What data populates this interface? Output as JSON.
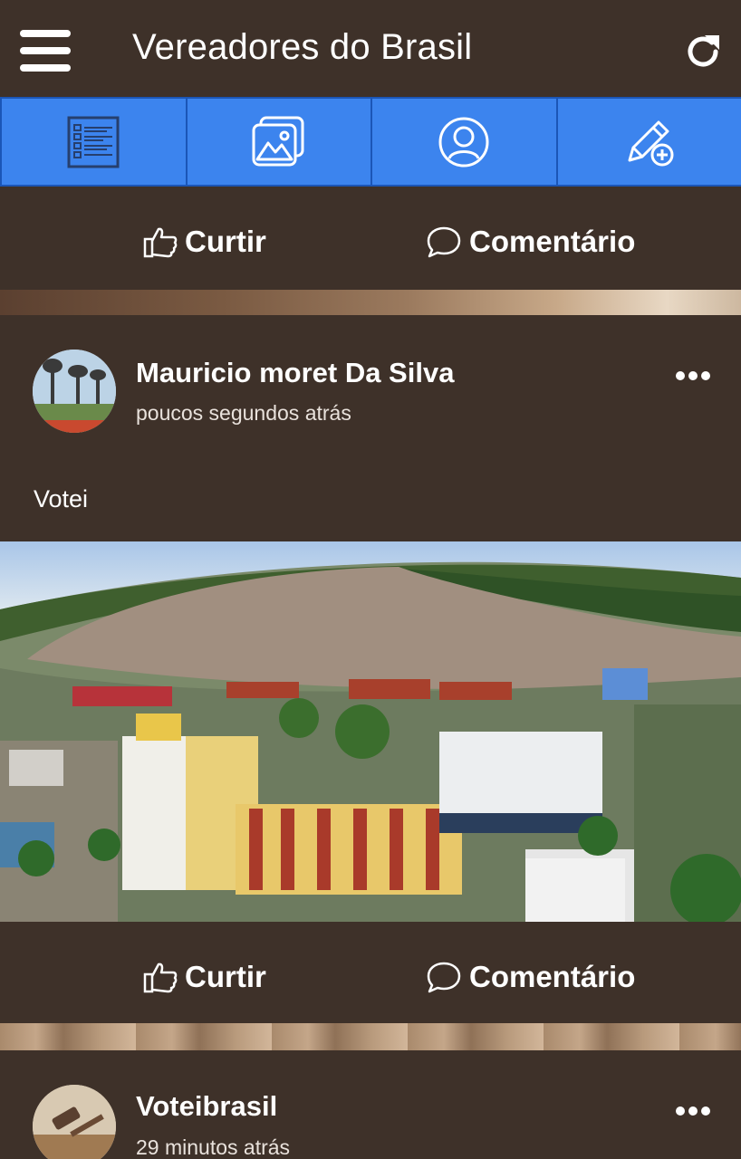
{
  "header": {
    "title": "Vereadores do Brasil",
    "menu_icon": "hamburger-menu-icon",
    "refresh_icon": "refresh-icon"
  },
  "tabs": [
    {
      "icon": "feed-list-icon"
    },
    {
      "icon": "gallery-icon"
    },
    {
      "icon": "profile-icon"
    },
    {
      "icon": "edit-add-icon"
    }
  ],
  "actions_top": {
    "like_label": "Curtir",
    "comment_label": "Comentário"
  },
  "posts": [
    {
      "author": "Mauricio moret Da Silva",
      "time": "poucos segundos atrás",
      "text": "Votei",
      "like_label": "Curtir",
      "comment_label": "Comentário"
    },
    {
      "author": "Voteibrasil",
      "time": "29 minutos atrás"
    }
  ],
  "colors": {
    "background": "#3e3129",
    "tabbar": "#3c84ee",
    "tab_divider": "#1b56b7",
    "text": "#ffffff"
  }
}
